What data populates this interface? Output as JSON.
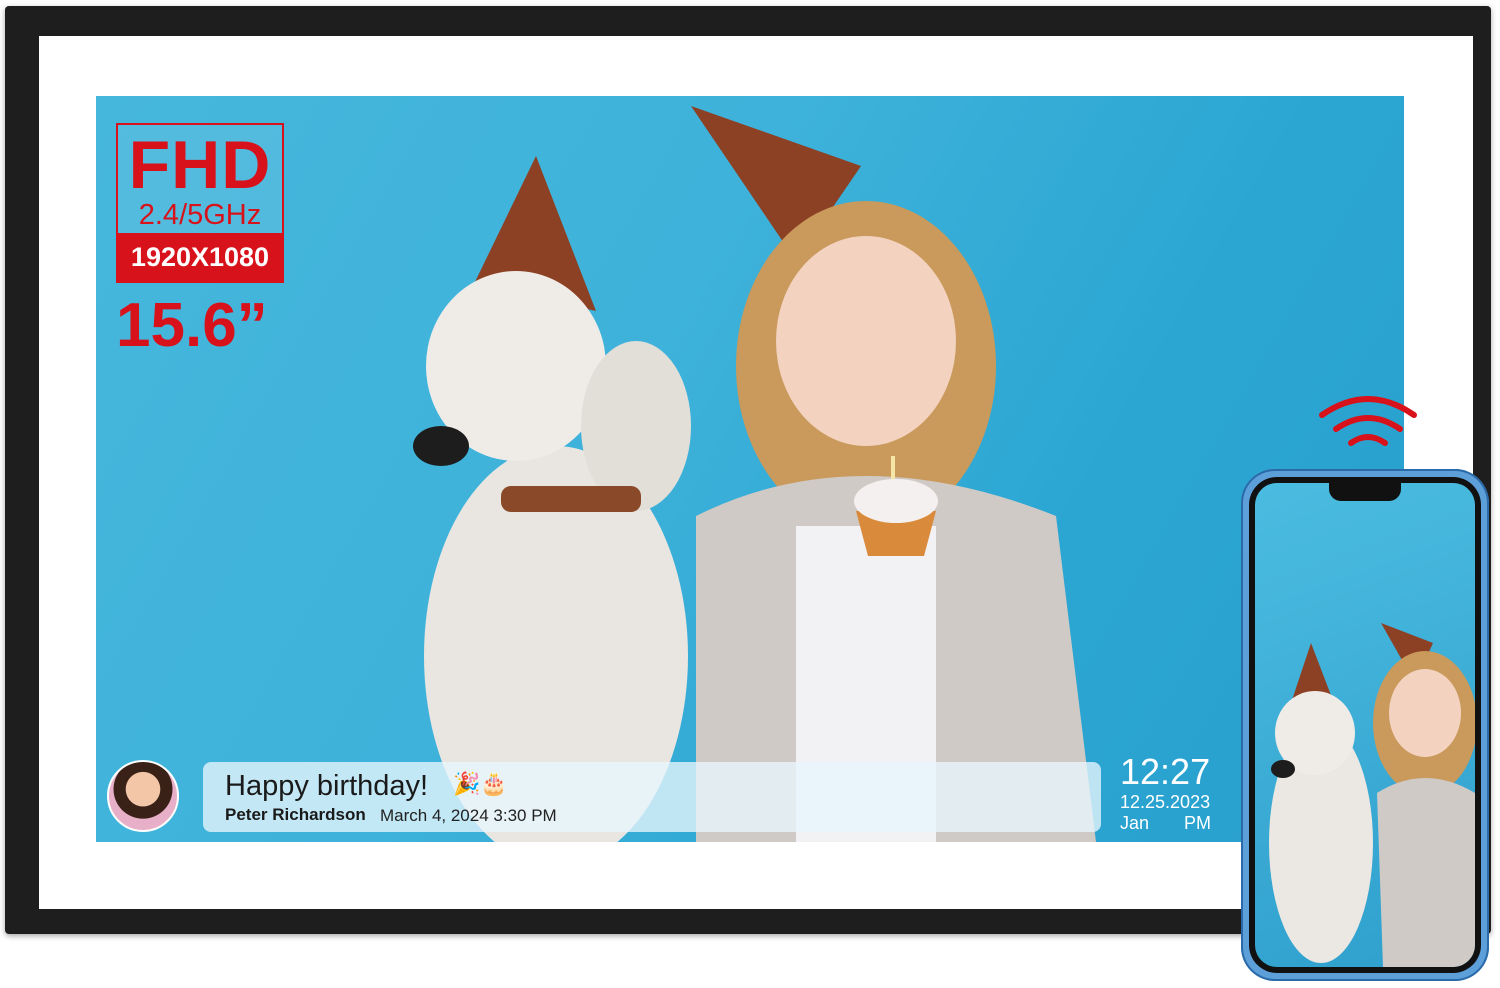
{
  "specs": {
    "resolution_class": "FHD",
    "band": "2.4/5GHz",
    "resolution": "1920X1080",
    "screen_size": "15.6”"
  },
  "message": {
    "text": "Happy birthday!",
    "emoji": "🎉🎂",
    "sender": "Peter Richardson",
    "timestamp": "March 4, 2024 3:30 PM"
  },
  "clock": {
    "time": "12:27",
    "date": "12.25.2023",
    "month": "Jan",
    "period": "PM"
  },
  "colors": {
    "accent": "#d8121b",
    "frame": "#1e1e1e",
    "backdrop": "#3eb2da",
    "phone_body": "#5d9fd8"
  },
  "icons": [
    "wifi-icon",
    "avatar"
  ]
}
